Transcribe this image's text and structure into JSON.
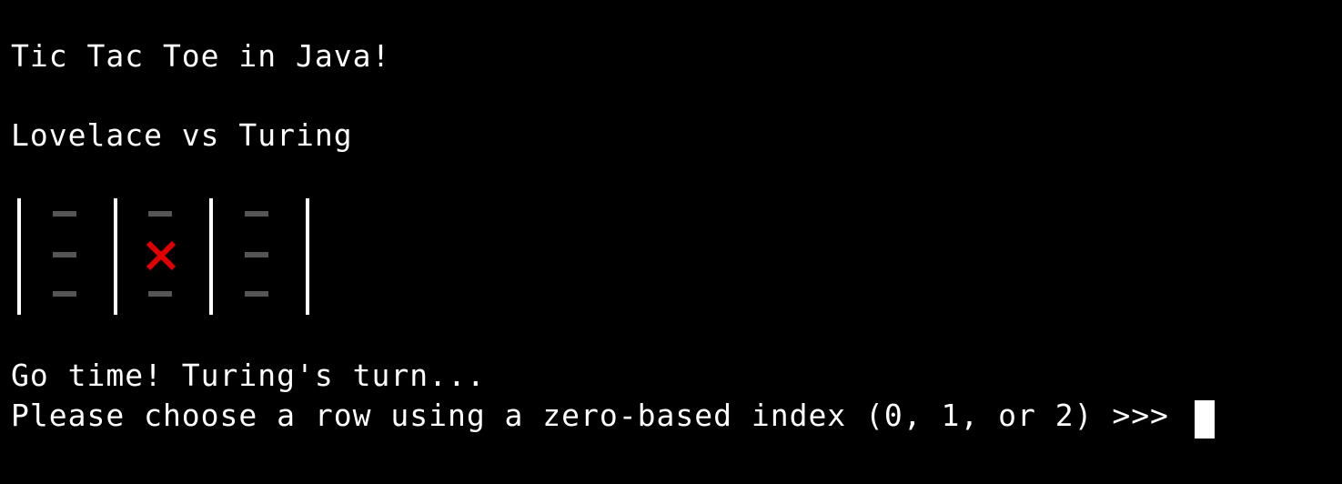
{
  "terminal": {
    "title_line": "Tic Tac Toe in Java!",
    "players_line": "Lovelace vs Turing",
    "status_line": "Go time! Turing's turn...",
    "prompt_line": "Please choose a row using a zero-based index (0, 1, or 2) >>> "
  },
  "board": {
    "rows": [
      [
        "empty",
        "empty",
        "empty"
      ],
      [
        "empty",
        "X",
        "empty"
      ],
      [
        "empty",
        "empty",
        "empty"
      ]
    ]
  },
  "colors": {
    "background": "#000000",
    "text": "#ffffff",
    "empty_mark": "#555555",
    "x_mark": "#e00000",
    "cursor": "#ffffff"
  },
  "icons": {
    "x_mark": "x-mark-icon",
    "empty_cell": "empty-cell-icon",
    "cursor": "block-cursor"
  }
}
